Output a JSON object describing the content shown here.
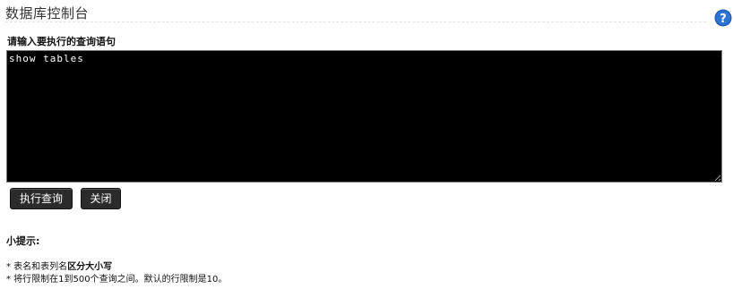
{
  "header": {
    "title": "数据库控制台"
  },
  "query": {
    "label": "请输入要执行的查询语句",
    "value": "show tables"
  },
  "buttons": {
    "execute_label": "执行查询",
    "close_label": "关闭"
  },
  "tips": {
    "title": "小提示:",
    "items": [
      {
        "bullet": "*",
        "text_before": " 表名和表列名",
        "emphasis": "区分大小写",
        "text_after": ""
      },
      {
        "bullet": "*",
        "text_before": " 将行限制在1到500个查询之间。默认的行限制是10。",
        "emphasis": "",
        "text_after": ""
      }
    ]
  },
  "colors": {
    "console_bg": "#000000",
    "console_text": "#ffffff",
    "button_bg": "#2b2b2b",
    "help_icon": "#1f5fb8"
  },
  "icons": {
    "help": "help-icon"
  }
}
